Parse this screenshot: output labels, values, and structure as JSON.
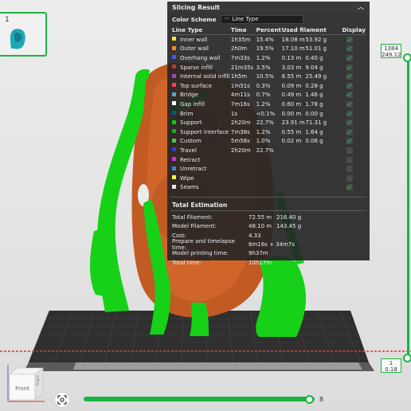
{
  "thumbnail": {
    "plate_number": "1"
  },
  "panel": {
    "title": "Slicing Result",
    "color_scheme_label": "Color Scheme",
    "color_scheme_value": "Line Type",
    "columns": {
      "type": "Line Type",
      "time": "Time",
      "percent": "Percent",
      "filament": "Used filament",
      "display": "Display"
    },
    "rows": [
      {
        "type": "Inner wall",
        "color": "#f7e34a",
        "time": "1h35m",
        "percent": "15.4%",
        "length": "18.08 m",
        "weight": "53.92 g",
        "shown": true
      },
      {
        "type": "Outer wall",
        "color": "#ff8c20",
        "time": "2h0m",
        "percent": "19.5%",
        "length": "17.10 m",
        "weight": "51.01 g",
        "shown": true
      },
      {
        "type": "Overhang wall",
        "color": "#4a5ae5",
        "time": "7m33s",
        "percent": "1.2%",
        "length": "0.13 m",
        "weight": "0.40 g",
        "shown": true
      },
      {
        "type": "Sparse infill",
        "color": "#ad3a3a",
        "time": "21m35s",
        "percent": "3.5%",
        "length": "3.03 m",
        "weight": "9.04 g",
        "shown": true
      },
      {
        "type": "Internal solid infill",
        "color": "#a145c1",
        "time": "1h5m",
        "percent": "10.5%",
        "length": "8.55 m",
        "weight": "25.49 g",
        "shown": true
      },
      {
        "type": "Top surface",
        "color": "#ff3e4e",
        "time": "1m51s",
        "percent": "0.3%",
        "length": "0.09 m",
        "weight": "0.28 g",
        "shown": true
      },
      {
        "type": "Bridge",
        "color": "#55a6c8",
        "time": "4m11s",
        "percent": "0.7%",
        "length": "0.49 m",
        "weight": "1.46 g",
        "shown": true
      },
      {
        "type": "Gap infill",
        "color": "#ffffff",
        "time": "7m16s",
        "percent": "1.2%",
        "length": "0.60 m",
        "weight": "1.78 g",
        "shown": true
      },
      {
        "type": "Brim",
        "color": "#00607a",
        "time": "1s",
        "percent": "<0.1%",
        "length": "0.00 m",
        "weight": "0.00 g",
        "shown": true
      },
      {
        "type": "Support",
        "color": "#00d400",
        "time": "2h20m",
        "percent": "22.7%",
        "length": "23.91 m",
        "weight": "71.31 g",
        "shown": true
      },
      {
        "type": "Support interface",
        "color": "#13a62a",
        "time": "7m38s",
        "percent": "1.2%",
        "length": "0.55 m",
        "weight": "1.64 g",
        "shown": true
      },
      {
        "type": "Custom",
        "color": "#4ec44e",
        "time": "5m58s",
        "percent": "1.0%",
        "length": "0.02 m",
        "weight": "0.06 g",
        "shown": true
      },
      {
        "type": "Travel",
        "color": "#3a3cc8",
        "time": "2h20m",
        "percent": "22.7%",
        "length": "",
        "weight": "",
        "shown": false
      },
      {
        "type": "Retract",
        "color": "#d62bd6",
        "time": "",
        "percent": "",
        "length": "",
        "weight": "",
        "shown": false
      },
      {
        "type": "Unretract",
        "color": "#4a80d8",
        "time": "",
        "percent": "",
        "length": "",
        "weight": "",
        "shown": false
      },
      {
        "type": "Wipe",
        "color": "#f5f23e",
        "time": "",
        "percent": "",
        "length": "",
        "weight": "",
        "shown": false
      },
      {
        "type": "Seams",
        "color": "#e8e8e8",
        "time": "",
        "percent": "",
        "length": "",
        "weight": "",
        "shown": true
      }
    ],
    "estimation_title": "Total Estimation",
    "estimation": [
      {
        "label": "Total Filament:",
        "v1": "72.55 m",
        "v2": "216.40 g"
      },
      {
        "label": "Model Filament:",
        "v1": "48.10 m",
        "v2": "143.45 g"
      },
      {
        "label": "Cost:",
        "v1": "4.33",
        "v2": ""
      },
      {
        "label": "Prepare and timelapse time:",
        "v1": "6m16s + 34m7s",
        "v2": ""
      },
      {
        "label": "Model printing time:",
        "v1": "9h37m",
        "v2": ""
      },
      {
        "label": "Total time:",
        "v1": "10h17m",
        "v2": ""
      }
    ]
  },
  "layer_slider": {
    "top_layer": "1384",
    "top_height": "249.12",
    "bottom_layer": "1",
    "bottom_height": "0.18"
  },
  "move_slider": {
    "value": "8"
  },
  "view_cube": {
    "front_label": "Front"
  },
  "colors": {
    "accent": "#19b541",
    "support": "#16d118",
    "model": "#c8612a"
  }
}
